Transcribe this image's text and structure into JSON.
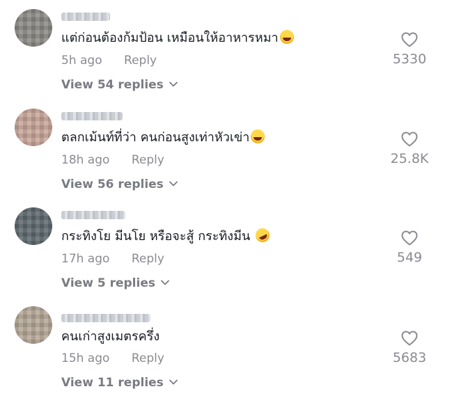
{
  "comments": [
    {
      "text": "แต่ก่อนต้องก้มป้อน เหมือนให้อาหารหมา",
      "time": "5h ago",
      "reply_label": "Reply",
      "view_replies": "View 54 replies",
      "likes": "5330",
      "emoji": "laughing-face",
      "avatar_color": "#8d8b86"
    },
    {
      "text": "ตลกเม้นท์ที่ว่า คนก่อนสูงเท่าหัวเข่า",
      "time": "18h ago",
      "reply_label": "Reply",
      "view_replies": "View 56 replies",
      "likes": "25.8K",
      "emoji": "laughing-face",
      "avatar_color": "#c9a69a"
    },
    {
      "text": "กระทิงโย มีนโย หรือจะสู้ กระทิงมีน",
      "time": "17h ago",
      "reply_label": "Reply",
      "view_replies": "View 5 replies",
      "likes": "549",
      "emoji": "rolling-laughing-face",
      "avatar_color": "#5f6a70"
    },
    {
      "text": "คนเก่าสูงเมตรครึ่ง",
      "time": "15h ago",
      "reply_label": "Reply",
      "view_replies": "View 11 replies",
      "likes": "5683",
      "emoji": "",
      "avatar_color": "#b6a898"
    }
  ],
  "icons": {
    "like": "heart-outline-icon",
    "expand": "chevron-down-icon"
  },
  "colors": {
    "text": "#161823",
    "secondary": "#8a8b91",
    "view_replies": "#7a7b82"
  }
}
